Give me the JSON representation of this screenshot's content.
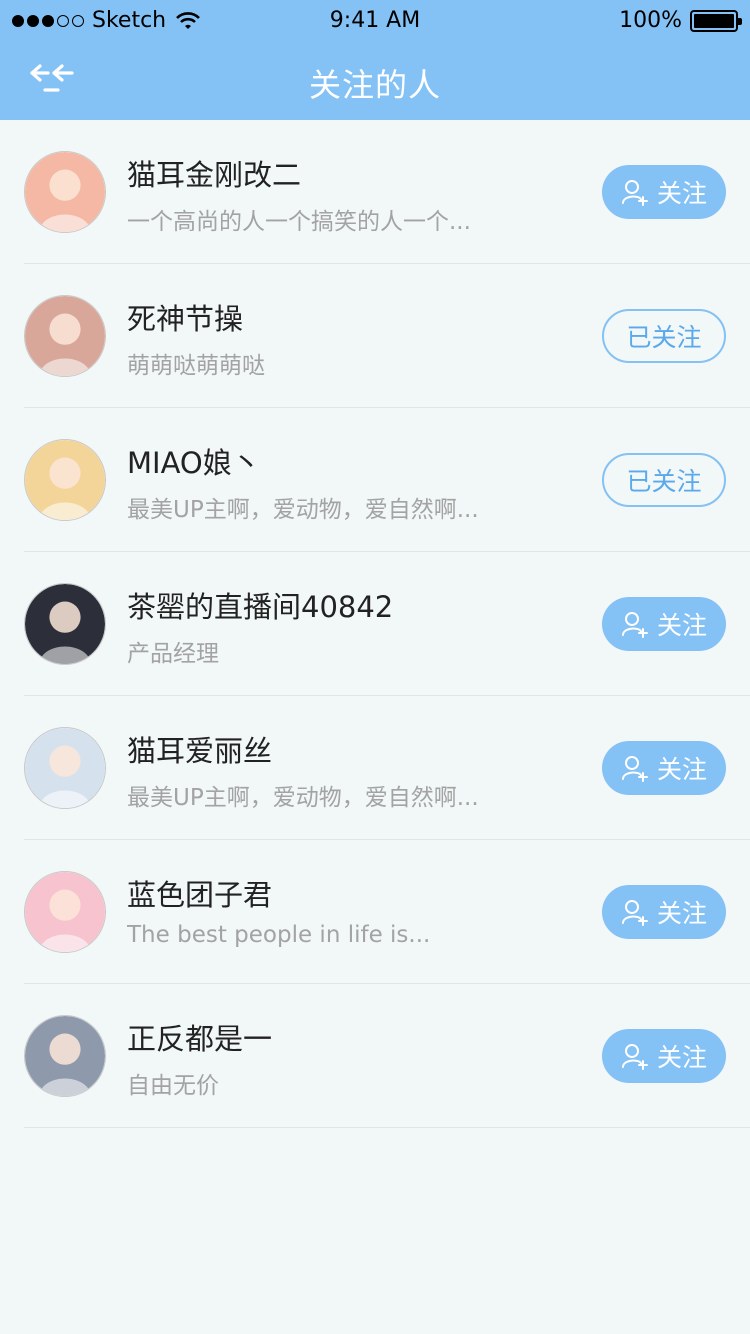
{
  "status_bar": {
    "carrier": "Sketch",
    "time": "9:41 AM",
    "battery": "100%"
  },
  "nav": {
    "title": "关注的人",
    "back_icon": "back-icon"
  },
  "colors": {
    "accent": "#84c1f5",
    "background": "#f2f7f8"
  },
  "users": [
    {
      "name": "猫耳金刚改二",
      "desc": "一个高尚的人一个搞笑的人一个...",
      "button": "关注",
      "followed": false,
      "avatar_color": "#f4b8a4"
    },
    {
      "name": "死神节操",
      "desc": "萌萌哒萌萌哒",
      "button": "已关注",
      "followed": true,
      "avatar_color": "#d8a79a"
    },
    {
      "name": "MIAO娘丶",
      "desc": "最美UP主啊，爱动物，爱自然啊...",
      "button": "已关注",
      "followed": true,
      "avatar_color": "#f3d59a"
    },
    {
      "name": "茶罂的直播间40842",
      "desc": "产品经理",
      "button": "关注",
      "followed": false,
      "avatar_color": "#2c2f3a"
    },
    {
      "name": "猫耳爱丽丝",
      "desc": "最美UP主啊，爱动物，爱自然啊...",
      "button": "关注",
      "followed": false,
      "avatar_color": "#d5e2ee"
    },
    {
      "name": "蓝色团子君",
      "desc": "The best people in life is...",
      "button": "关注",
      "followed": false,
      "avatar_color": "#f6c3cf"
    },
    {
      "name": "正反都是一",
      "desc": "自由无价",
      "button": "关注",
      "followed": false,
      "avatar_color": "#8e99ab"
    }
  ]
}
